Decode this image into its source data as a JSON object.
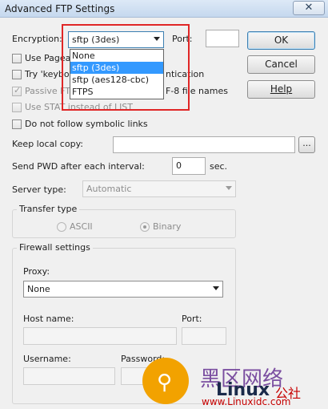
{
  "window": {
    "title": "Advanced FTP Settings",
    "close_glyph": "✕"
  },
  "encryption": {
    "label": "Encryption:",
    "selected": "sftp (3des)",
    "options": [
      "None",
      "sftp (3des)",
      "sftp (aes128-cbc)",
      "FTPS"
    ]
  },
  "port_top": {
    "label": "Port:",
    "value": ""
  },
  "buttons": {
    "ok": "OK",
    "cancel": "Cancel",
    "help": "Help"
  },
  "checkboxes": {
    "use_pageant": "Use Pagea",
    "try_keyboard": "Try 'keybo",
    "try_keyboard_tail": "ntication",
    "passive": "Passive FT",
    "passive_tail": "F-8 file names",
    "use_stat": "Use STAT instead of LIST",
    "do_not_follow": "Do not follow symbolic links"
  },
  "keep_local_copy": {
    "label": "Keep local copy:",
    "value": "",
    "browse": "..."
  },
  "send_pwd": {
    "label": "Send PWD after each interval:",
    "value": "0",
    "unit": "sec."
  },
  "server_type": {
    "label": "Server type:",
    "value": "Automatic"
  },
  "transfer_type": {
    "title": "Transfer type",
    "ascii": "ASCII",
    "binary": "Binary",
    "selected": "Binary"
  },
  "firewall": {
    "title": "Firewall settings",
    "proxy_label": "Proxy:",
    "proxy_value": "None",
    "host_label": "Host name:",
    "port_label": "Port:",
    "username_label": "Username:",
    "password_label": "Password:"
  },
  "watermark": {
    "cn": "黑区网络",
    "brand": "Linux",
    "brand2": "公社",
    "url": "www.Linuxidc.com"
  },
  "colors": {
    "accent": "#3399ff",
    "highlight_box": "#e02626"
  }
}
